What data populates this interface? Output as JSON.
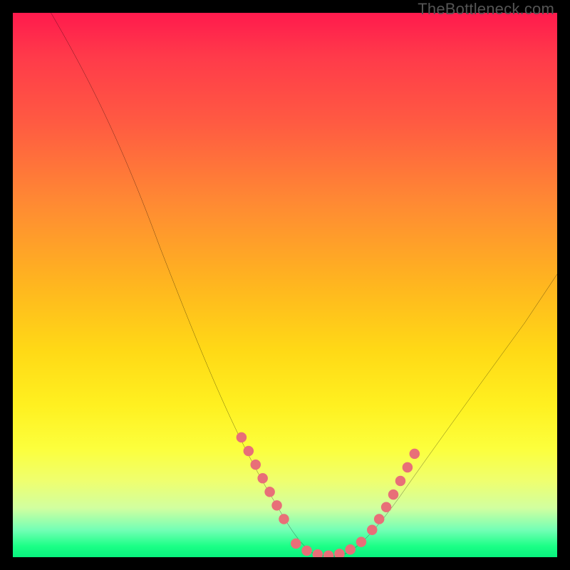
{
  "watermark": "TheBottleneck.com",
  "chart_data": {
    "type": "line",
    "title": "",
    "xlabel": "",
    "ylabel": "",
    "xlim": [
      0,
      100
    ],
    "ylim": [
      0,
      100
    ],
    "series": [
      {
        "name": "bottleneck-curve",
        "x": [
          7,
          12,
          17,
          22,
          27,
          32,
          37,
          42,
          47,
          50,
          53,
          56,
          59,
          62,
          65,
          70,
          75,
          80,
          85,
          90,
          95,
          100
        ],
        "y": [
          100,
          90,
          80,
          69,
          57,
          45,
          33,
          22,
          12,
          6,
          2,
          0,
          0,
          1,
          3,
          8,
          15,
          22,
          30,
          38,
          45,
          52
        ]
      }
    ],
    "marker_points": {
      "comment": "dotted pink segments near the valley",
      "left_branch": [
        {
          "x": 42,
          "y": 22
        },
        {
          "x": 43.5,
          "y": 19
        },
        {
          "x": 45,
          "y": 16
        },
        {
          "x": 46.5,
          "y": 13
        },
        {
          "x": 48,
          "y": 10
        },
        {
          "x": 49.5,
          "y": 7
        }
      ],
      "bottom": [
        {
          "x": 52,
          "y": 2
        },
        {
          "x": 54,
          "y": 0.8
        },
        {
          "x": 56,
          "y": 0
        },
        {
          "x": 58,
          "y": 0
        },
        {
          "x": 60,
          "y": 0.5
        },
        {
          "x": 62,
          "y": 1.2
        },
        {
          "x": 64,
          "y": 2.5
        }
      ],
      "right_branch": [
        {
          "x": 66,
          "y": 4.5
        },
        {
          "x": 67.5,
          "y": 6.5
        },
        {
          "x": 69,
          "y": 9
        },
        {
          "x": 70.5,
          "y": 11.5
        },
        {
          "x": 72,
          "y": 14
        },
        {
          "x": 73.5,
          "y": 16.5
        },
        {
          "x": 75,
          "y": 19
        }
      ]
    },
    "colors": {
      "curve": "#000000",
      "markers": "#e86f78",
      "gradient_top": "#ff1a4d",
      "gradient_bottom": "#08f27e"
    }
  }
}
